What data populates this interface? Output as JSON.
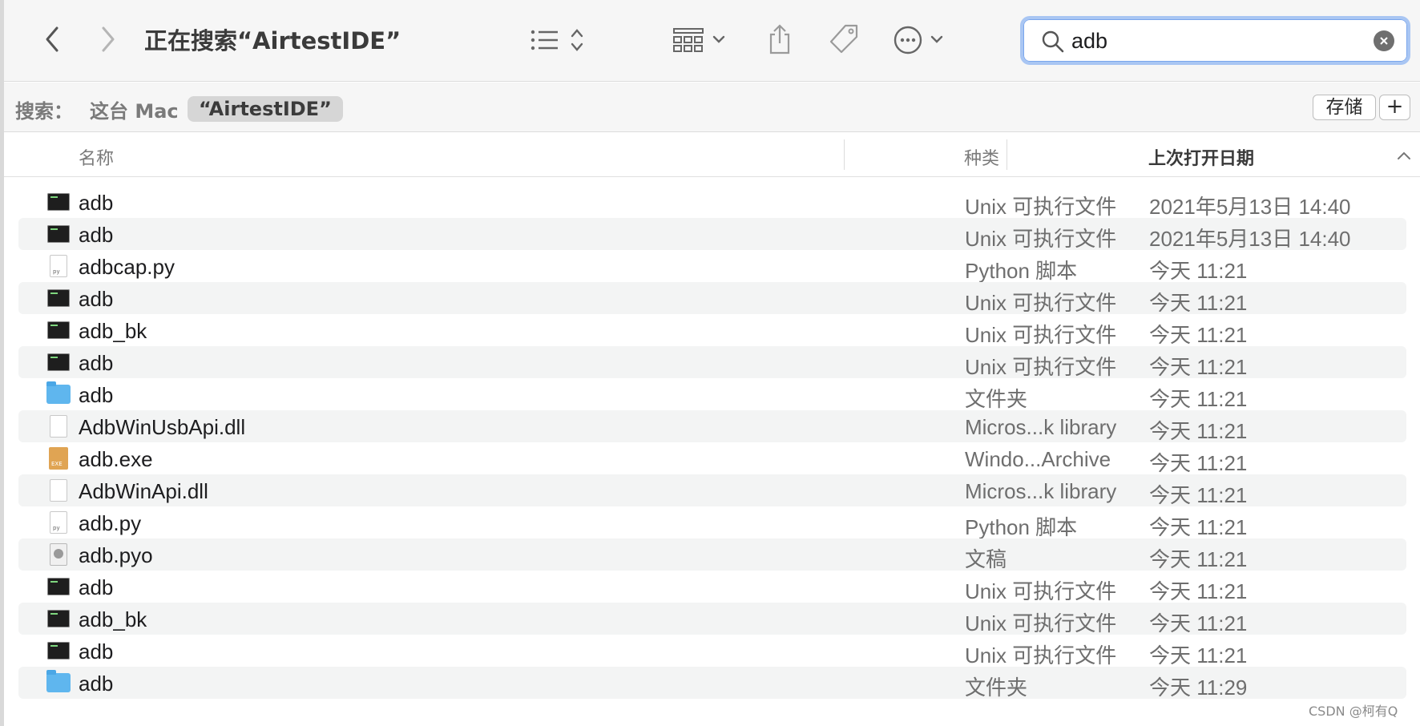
{
  "toolbar": {
    "title": "正在搜索“AirtestIDE”",
    "search_value": "adb"
  },
  "scope_bar": {
    "label": "搜索：",
    "scope_this_mac": "这台 Mac",
    "scope_folder": "“AirtestIDE”",
    "save_label": "存储",
    "add_label": "+"
  },
  "columns": {
    "name": "名称",
    "kind": "种类",
    "date": "上次打开日期"
  },
  "rows": [
    {
      "icon": "terminal-exec-icon",
      "name": "adb",
      "kind": "Unix 可执行文件",
      "date": "2021年5月13日 14:40"
    },
    {
      "icon": "terminal-exec-icon",
      "name": "adb",
      "kind": "Unix 可执行文件",
      "date": "2021年5月13日 14:40"
    },
    {
      "icon": "python-file-icon",
      "name": "adbcap.py",
      "kind": "Python 脚本",
      "date": "今天 11:21"
    },
    {
      "icon": "terminal-exec-icon",
      "name": "adb",
      "kind": "Unix 可执行文件",
      "date": "今天 11:21"
    },
    {
      "icon": "terminal-exec-icon",
      "name": "adb_bk",
      "kind": "Unix 可执行文件",
      "date": "今天 11:21"
    },
    {
      "icon": "terminal-exec-icon",
      "name": "adb",
      "kind": "Unix 可执行文件",
      "date": "今天 11:21"
    },
    {
      "icon": "folder-icon",
      "name": "adb",
      "kind": "文件夹",
      "date": "今天 11:21"
    },
    {
      "icon": "blank-doc-icon",
      "name": "AdbWinUsbApi.dll",
      "kind": "Micros...k library",
      "date": "今天 11:21"
    },
    {
      "icon": "exe-archive-icon",
      "name": "adb.exe",
      "kind": "Windo...Archive",
      "date": "今天 11:21"
    },
    {
      "icon": "blank-doc-icon",
      "name": "AdbWinApi.dll",
      "kind": "Micros...k library",
      "date": "今天 11:21"
    },
    {
      "icon": "python-file-icon",
      "name": "adb.py",
      "kind": "Python 脚本",
      "date": "今天 11:21"
    },
    {
      "icon": "pyo-doc-icon",
      "name": "adb.pyo",
      "kind": "文稿",
      "date": "今天 11:21"
    },
    {
      "icon": "terminal-exec-icon",
      "name": "adb",
      "kind": "Unix 可执行文件",
      "date": "今天 11:21"
    },
    {
      "icon": "terminal-exec-icon",
      "name": "adb_bk",
      "kind": "Unix 可执行文件",
      "date": "今天 11:21"
    },
    {
      "icon": "terminal-exec-icon",
      "name": "adb",
      "kind": "Unix 可执行文件",
      "date": "今天 11:21"
    },
    {
      "icon": "folder-icon",
      "name": "adb",
      "kind": "文件夹",
      "date": "今天 11:29"
    }
  ],
  "watermark": "CSDN @柯有Q"
}
